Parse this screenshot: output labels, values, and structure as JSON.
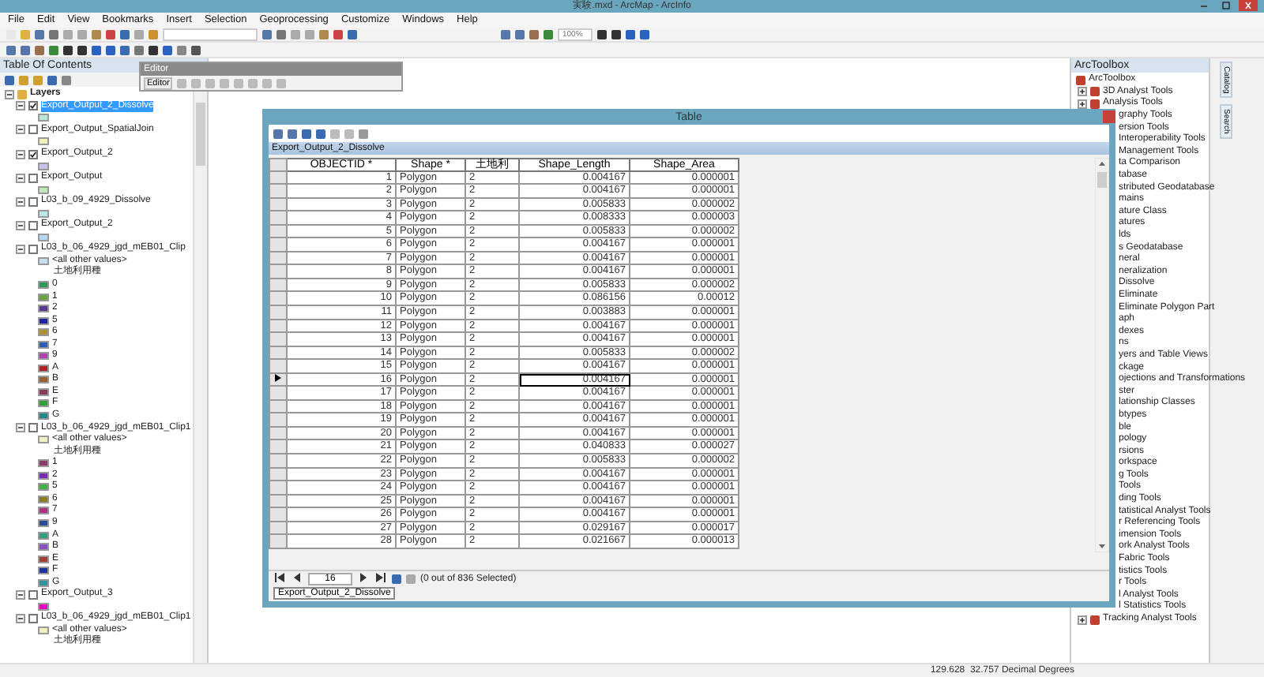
{
  "window": {
    "title": "実験.mxd - ArcMap - ArcInfo"
  },
  "menu": [
    "File",
    "Edit",
    "View",
    "Bookmarks",
    "Insert",
    "Selection",
    "Geoprocessing",
    "Customize",
    "Windows",
    "Help"
  ],
  "layout_zoom": "100%",
  "editor_toolbar": {
    "title": "Editor",
    "menu": "Editor"
  },
  "toc": {
    "title": "Table Of Contents",
    "root": "Layers",
    "layers": [
      {
        "name": "Export_Output_2_Dissolve",
        "checked": true,
        "selected": true,
        "legend": [
          {
            "color": "#b8e8d8"
          }
        ]
      },
      {
        "name": "Export_Output_SpatialJoin",
        "checked": false,
        "selected": false,
        "legend": [
          {
            "color": "#f0f0b8"
          }
        ]
      },
      {
        "name": "Export_Output_2",
        "checked": true,
        "selected": false,
        "legend": [
          {
            "color": "#c8c0e8"
          }
        ]
      },
      {
        "name": "Export_Output",
        "checked": false,
        "selected": false,
        "legend": [
          {
            "color": "#c0e8b8"
          }
        ]
      },
      {
        "name": "L03_b_09_4929_Dissolve",
        "checked": false,
        "selected": false,
        "legend": [
          {
            "color": "#b8e8e8"
          }
        ]
      },
      {
        "name": "Export_Output_2",
        "checked": false,
        "selected": false,
        "legend": [
          {
            "color": "#b8d8f0"
          }
        ]
      },
      {
        "name": "L03_b_06_4929_jgd_mEB01_Clip",
        "checked": false,
        "selected": false,
        "legend": [
          {
            "label": "<all other values>",
            "color": "#c8e0f0"
          },
          {
            "label": "土地利用種",
            "kind": "heading"
          },
          {
            "label": "0",
            "color": "#2a9a5a"
          },
          {
            "label": "1",
            "color": "#6aa040"
          },
          {
            "label": "2",
            "color": "#5a3a90"
          },
          {
            "label": "5",
            "color": "#2020a0"
          },
          {
            "label": "6",
            "color": "#b09030"
          },
          {
            "label": "7",
            "color": "#2a60b0"
          },
          {
            "label": "9",
            "color": "#b040b0"
          },
          {
            "label": "A",
            "color": "#b02020"
          },
          {
            "label": "B",
            "color": "#9a6030"
          },
          {
            "label": "E",
            "color": "#8a3a5a"
          },
          {
            "label": "F",
            "color": "#30a030"
          },
          {
            "label": "G",
            "color": "#208888"
          }
        ]
      },
      {
        "name": "L03_b_06_4929_jgd_mEB01_Clip1",
        "checked": false,
        "selected": false,
        "legend": [
          {
            "label": "<all other values>",
            "color": "#f0f0c0"
          },
          {
            "label": "土地利用種",
            "kind": "heading"
          },
          {
            "label": "1",
            "color": "#8a3a6a"
          },
          {
            "label": "2",
            "color": "#7a2ab0"
          },
          {
            "label": "5",
            "color": "#40b040"
          },
          {
            "label": "6",
            "color": "#8a7a20"
          },
          {
            "label": "7",
            "color": "#b03080"
          },
          {
            "label": "9",
            "color": "#2a4a90"
          },
          {
            "label": "A",
            "color": "#30a080"
          },
          {
            "label": "B",
            "color": "#8a50c0"
          },
          {
            "label": "E",
            "color": "#a04030"
          },
          {
            "label": "F",
            "color": "#2030a0"
          },
          {
            "label": "G",
            "color": "#3090a0"
          }
        ]
      },
      {
        "name": "Export_Output_3",
        "checked": false,
        "selected": false,
        "legend": [
          {
            "color": "#f000c0"
          }
        ]
      },
      {
        "name": "L03_b_06_4929_jgd_mEB01_Clip1",
        "checked": false,
        "selected": false,
        "legend": [
          {
            "label": "<all other values>",
            "color": "#f0f0c0"
          },
          {
            "label": "土地利用種",
            "kind": "heading"
          }
        ]
      }
    ]
  },
  "table": {
    "title": "Table",
    "layer": "Export_Output_2_Dissolve",
    "columns": [
      "OBJECTID *",
      "Shape *",
      "土地利",
      "Shape_Length",
      "Shape_Area"
    ],
    "rows": [
      {
        "cells": [
          "1",
          "Polygon",
          "2",
          "0.004167",
          "0.000001"
        ],
        "current": false
      },
      {
        "cells": [
          "2",
          "Polygon",
          "2",
          "0.004167",
          "0.000001"
        ],
        "current": false
      },
      {
        "cells": [
          "3",
          "Polygon",
          "2",
          "0.005833",
          "0.000002"
        ],
        "current": false
      },
      {
        "cells": [
          "4",
          "Polygon",
          "2",
          "0.008333",
          "0.000003"
        ],
        "current": false
      },
      {
        "cells": [
          "5",
          "Polygon",
          "2",
          "0.005833",
          "0.000002"
        ],
        "current": false
      },
      {
        "cells": [
          "6",
          "Polygon",
          "2",
          "0.004167",
          "0.000001"
        ],
        "current": false
      },
      {
        "cells": [
          "7",
          "Polygon",
          "2",
          "0.004167",
          "0.000001"
        ],
        "current": false
      },
      {
        "cells": [
          "8",
          "Polygon",
          "2",
          "0.004167",
          "0.000001"
        ],
        "current": false
      },
      {
        "cells": [
          "9",
          "Polygon",
          "2",
          "0.005833",
          "0.000002"
        ],
        "current": false
      },
      {
        "cells": [
          "10",
          "Polygon",
          "2",
          "0.086156",
          "0.00012"
        ],
        "current": false
      },
      {
        "cells": [
          "11",
          "Polygon",
          "2",
          "0.003883",
          "0.000001"
        ],
        "current": false
      },
      {
        "cells": [
          "12",
          "Polygon",
          "2",
          "0.004167",
          "0.000001"
        ],
        "current": false
      },
      {
        "cells": [
          "13",
          "Polygon",
          "2",
          "0.004167",
          "0.000001"
        ],
        "current": false
      },
      {
        "cells": [
          "14",
          "Polygon",
          "2",
          "0.005833",
          "0.000002"
        ],
        "current": false
      },
      {
        "cells": [
          "15",
          "Polygon",
          "2",
          "0.004167",
          "0.000001"
        ],
        "current": false
      },
      {
        "cells": [
          "16",
          "Polygon",
          "2",
          "0.004167",
          "0.000001"
        ],
        "current": true
      },
      {
        "cells": [
          "17",
          "Polygon",
          "2",
          "0.004167",
          "0.000001"
        ],
        "current": false
      },
      {
        "cells": [
          "18",
          "Polygon",
          "2",
          "0.004167",
          "0.000001"
        ],
        "current": false
      },
      {
        "cells": [
          "19",
          "Polygon",
          "2",
          "0.004167",
          "0.000001"
        ],
        "current": false
      },
      {
        "cells": [
          "20",
          "Polygon",
          "2",
          "0.004167",
          "0.000001"
        ],
        "current": false
      },
      {
        "cells": [
          "21",
          "Polygon",
          "2",
          "0.040833",
          "0.000027"
        ],
        "current": false
      },
      {
        "cells": [
          "22",
          "Polygon",
          "2",
          "0.005833",
          "0.000002"
        ],
        "current": false
      },
      {
        "cells": [
          "23",
          "Polygon",
          "2",
          "0.004167",
          "0.000001"
        ],
        "current": false
      },
      {
        "cells": [
          "24",
          "Polygon",
          "2",
          "0.004167",
          "0.000001"
        ],
        "current": false
      },
      {
        "cells": [
          "25",
          "Polygon",
          "2",
          "0.004167",
          "0.000001"
        ],
        "current": false
      },
      {
        "cells": [
          "26",
          "Polygon",
          "2",
          "0.004167",
          "0.000001"
        ],
        "current": false
      },
      {
        "cells": [
          "27",
          "Polygon",
          "2",
          "0.029167",
          "0.000017"
        ],
        "current": false
      },
      {
        "cells": [
          "28",
          "Polygon",
          "2",
          "0.021667",
          "0.000013"
        ],
        "current": false
      }
    ],
    "record": "16",
    "selection": "(0 out of 836 Selected)",
    "tabs": [
      {
        "label": "Export_Output_2_Dissolve",
        "selected": true
      }
    ]
  },
  "toolbox": {
    "title": "ArcToolbox",
    "items": [
      {
        "kind": "root",
        "label": "ArcToolbox"
      },
      {
        "kind": "toolbox",
        "label": "3D Analyst Tools"
      },
      {
        "kind": "toolbox",
        "label": "Analysis Tools"
      },
      {
        "kind": "clipped",
        "label": "graphy Tools"
      },
      {
        "kind": "clipped",
        "label": "ersion Tools"
      },
      {
        "kind": "clipped",
        "label": "Interoperability Tools"
      },
      {
        "kind": "clipped",
        "label": "Management Tools"
      },
      {
        "kind": "clipped",
        "label": "ta Comparison"
      },
      {
        "kind": "clipped",
        "label": "tabase"
      },
      {
        "kind": "clipped",
        "label": "stributed Geodatabase"
      },
      {
        "kind": "clipped",
        "label": "mains"
      },
      {
        "kind": "clipped",
        "label": "ature Class"
      },
      {
        "kind": "clipped",
        "label": "atures"
      },
      {
        "kind": "clipped",
        "label": "lds"
      },
      {
        "kind": "clipped",
        "label": "s Geodatabase"
      },
      {
        "kind": "clipped",
        "label": "neral"
      },
      {
        "kind": "clipped",
        "label": "neralization"
      },
      {
        "kind": "clipped",
        "label": "Dissolve"
      },
      {
        "kind": "clipped",
        "label": "Eliminate"
      },
      {
        "kind": "clipped",
        "label": "Eliminate Polygon Part"
      },
      {
        "kind": "clipped",
        "label": "aph"
      },
      {
        "kind": "clipped",
        "label": "dexes"
      },
      {
        "kind": "clipped",
        "label": "ns"
      },
      {
        "kind": "clipped",
        "label": "yers and Table Views"
      },
      {
        "kind": "clipped",
        "label": "ckage"
      },
      {
        "kind": "clipped",
        "label": "ojections and Transformations"
      },
      {
        "kind": "clipped",
        "label": "ster"
      },
      {
        "kind": "clipped",
        "label": "lationship Classes"
      },
      {
        "kind": "clipped",
        "label": "btypes"
      },
      {
        "kind": "clipped",
        "label": "ble"
      },
      {
        "kind": "clipped",
        "label": "pology"
      },
      {
        "kind": "clipped",
        "label": "rsions"
      },
      {
        "kind": "clipped",
        "label": "orkspace"
      },
      {
        "kind": "clipped",
        "label": "g Tools"
      },
      {
        "kind": "clipped",
        "label": "Tools"
      },
      {
        "kind": "clipped",
        "label": "ding Tools"
      },
      {
        "kind": "clipped",
        "label": "tatistical Analyst Tools"
      },
      {
        "kind": "clipped",
        "label": "r Referencing Tools"
      },
      {
        "kind": "clipped",
        "label": "imension Tools"
      },
      {
        "kind": "clipped",
        "label": "ork Analyst Tools"
      },
      {
        "kind": "clipped",
        "label": "Fabric Tools"
      },
      {
        "kind": "clipped",
        "label": "tistics Tools"
      },
      {
        "kind": "clipped",
        "label": "r Tools"
      },
      {
        "kind": "clipped",
        "label": "l Analyst Tools"
      },
      {
        "kind": "clipped",
        "label": "l Statistics Tools"
      },
      {
        "kind": "toolbox",
        "label": "Tracking Analyst Tools"
      }
    ]
  },
  "side_tabs": [
    "Catalog",
    "Search"
  ],
  "status_bar": "129.628  32.757 Decimal Degrees"
}
